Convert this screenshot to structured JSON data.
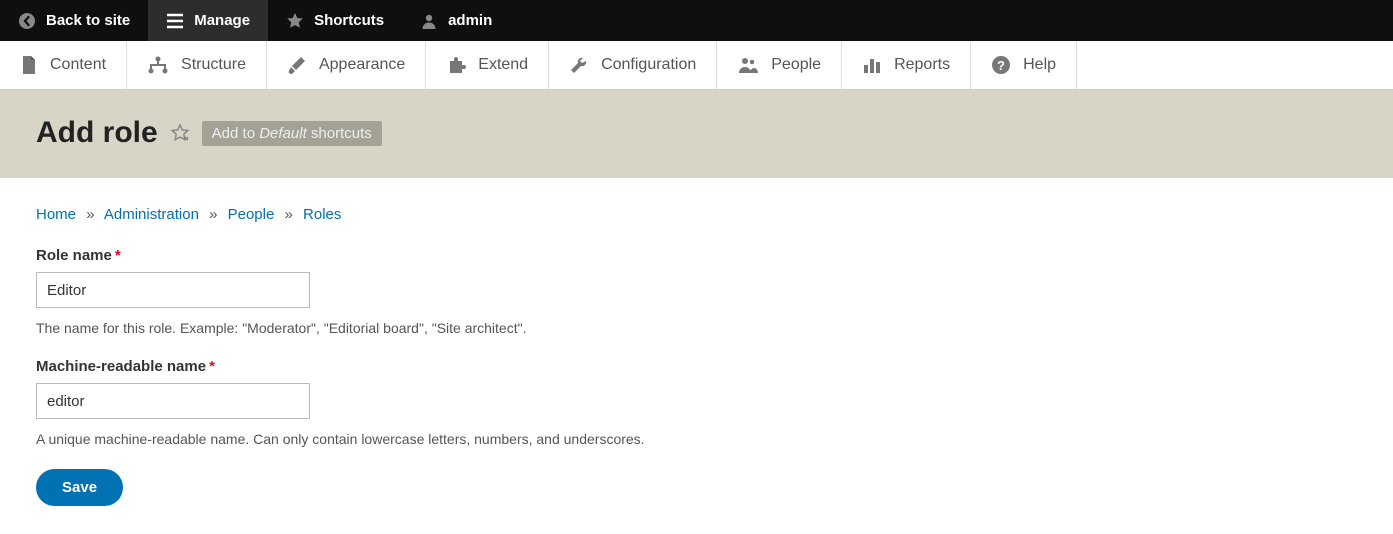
{
  "toolbar": {
    "back": "Back to site",
    "manage": "Manage",
    "shortcuts": "Shortcuts",
    "user": "admin"
  },
  "admin_menu": {
    "content": "Content",
    "structure": "Structure",
    "appearance": "Appearance",
    "extend": "Extend",
    "configuration": "Configuration",
    "people": "People",
    "reports": "Reports",
    "help": "Help"
  },
  "page": {
    "title": "Add role",
    "tooltip_prefix": "Add to ",
    "tooltip_italic": "Default",
    "tooltip_suffix": " shortcuts"
  },
  "breadcrumb": {
    "home": "Home",
    "administration": "Administration",
    "people": "People",
    "roles": "Roles"
  },
  "form": {
    "role_label": "Role name",
    "role_value": "Editor",
    "role_help": "The name for this role. Example: \"Moderator\", \"Editorial board\", \"Site architect\".",
    "machine_label": "Machine-readable name",
    "machine_value": "editor",
    "machine_help": "A unique machine-readable name. Can only contain lowercase letters, numbers, and underscores.",
    "save": "Save"
  }
}
